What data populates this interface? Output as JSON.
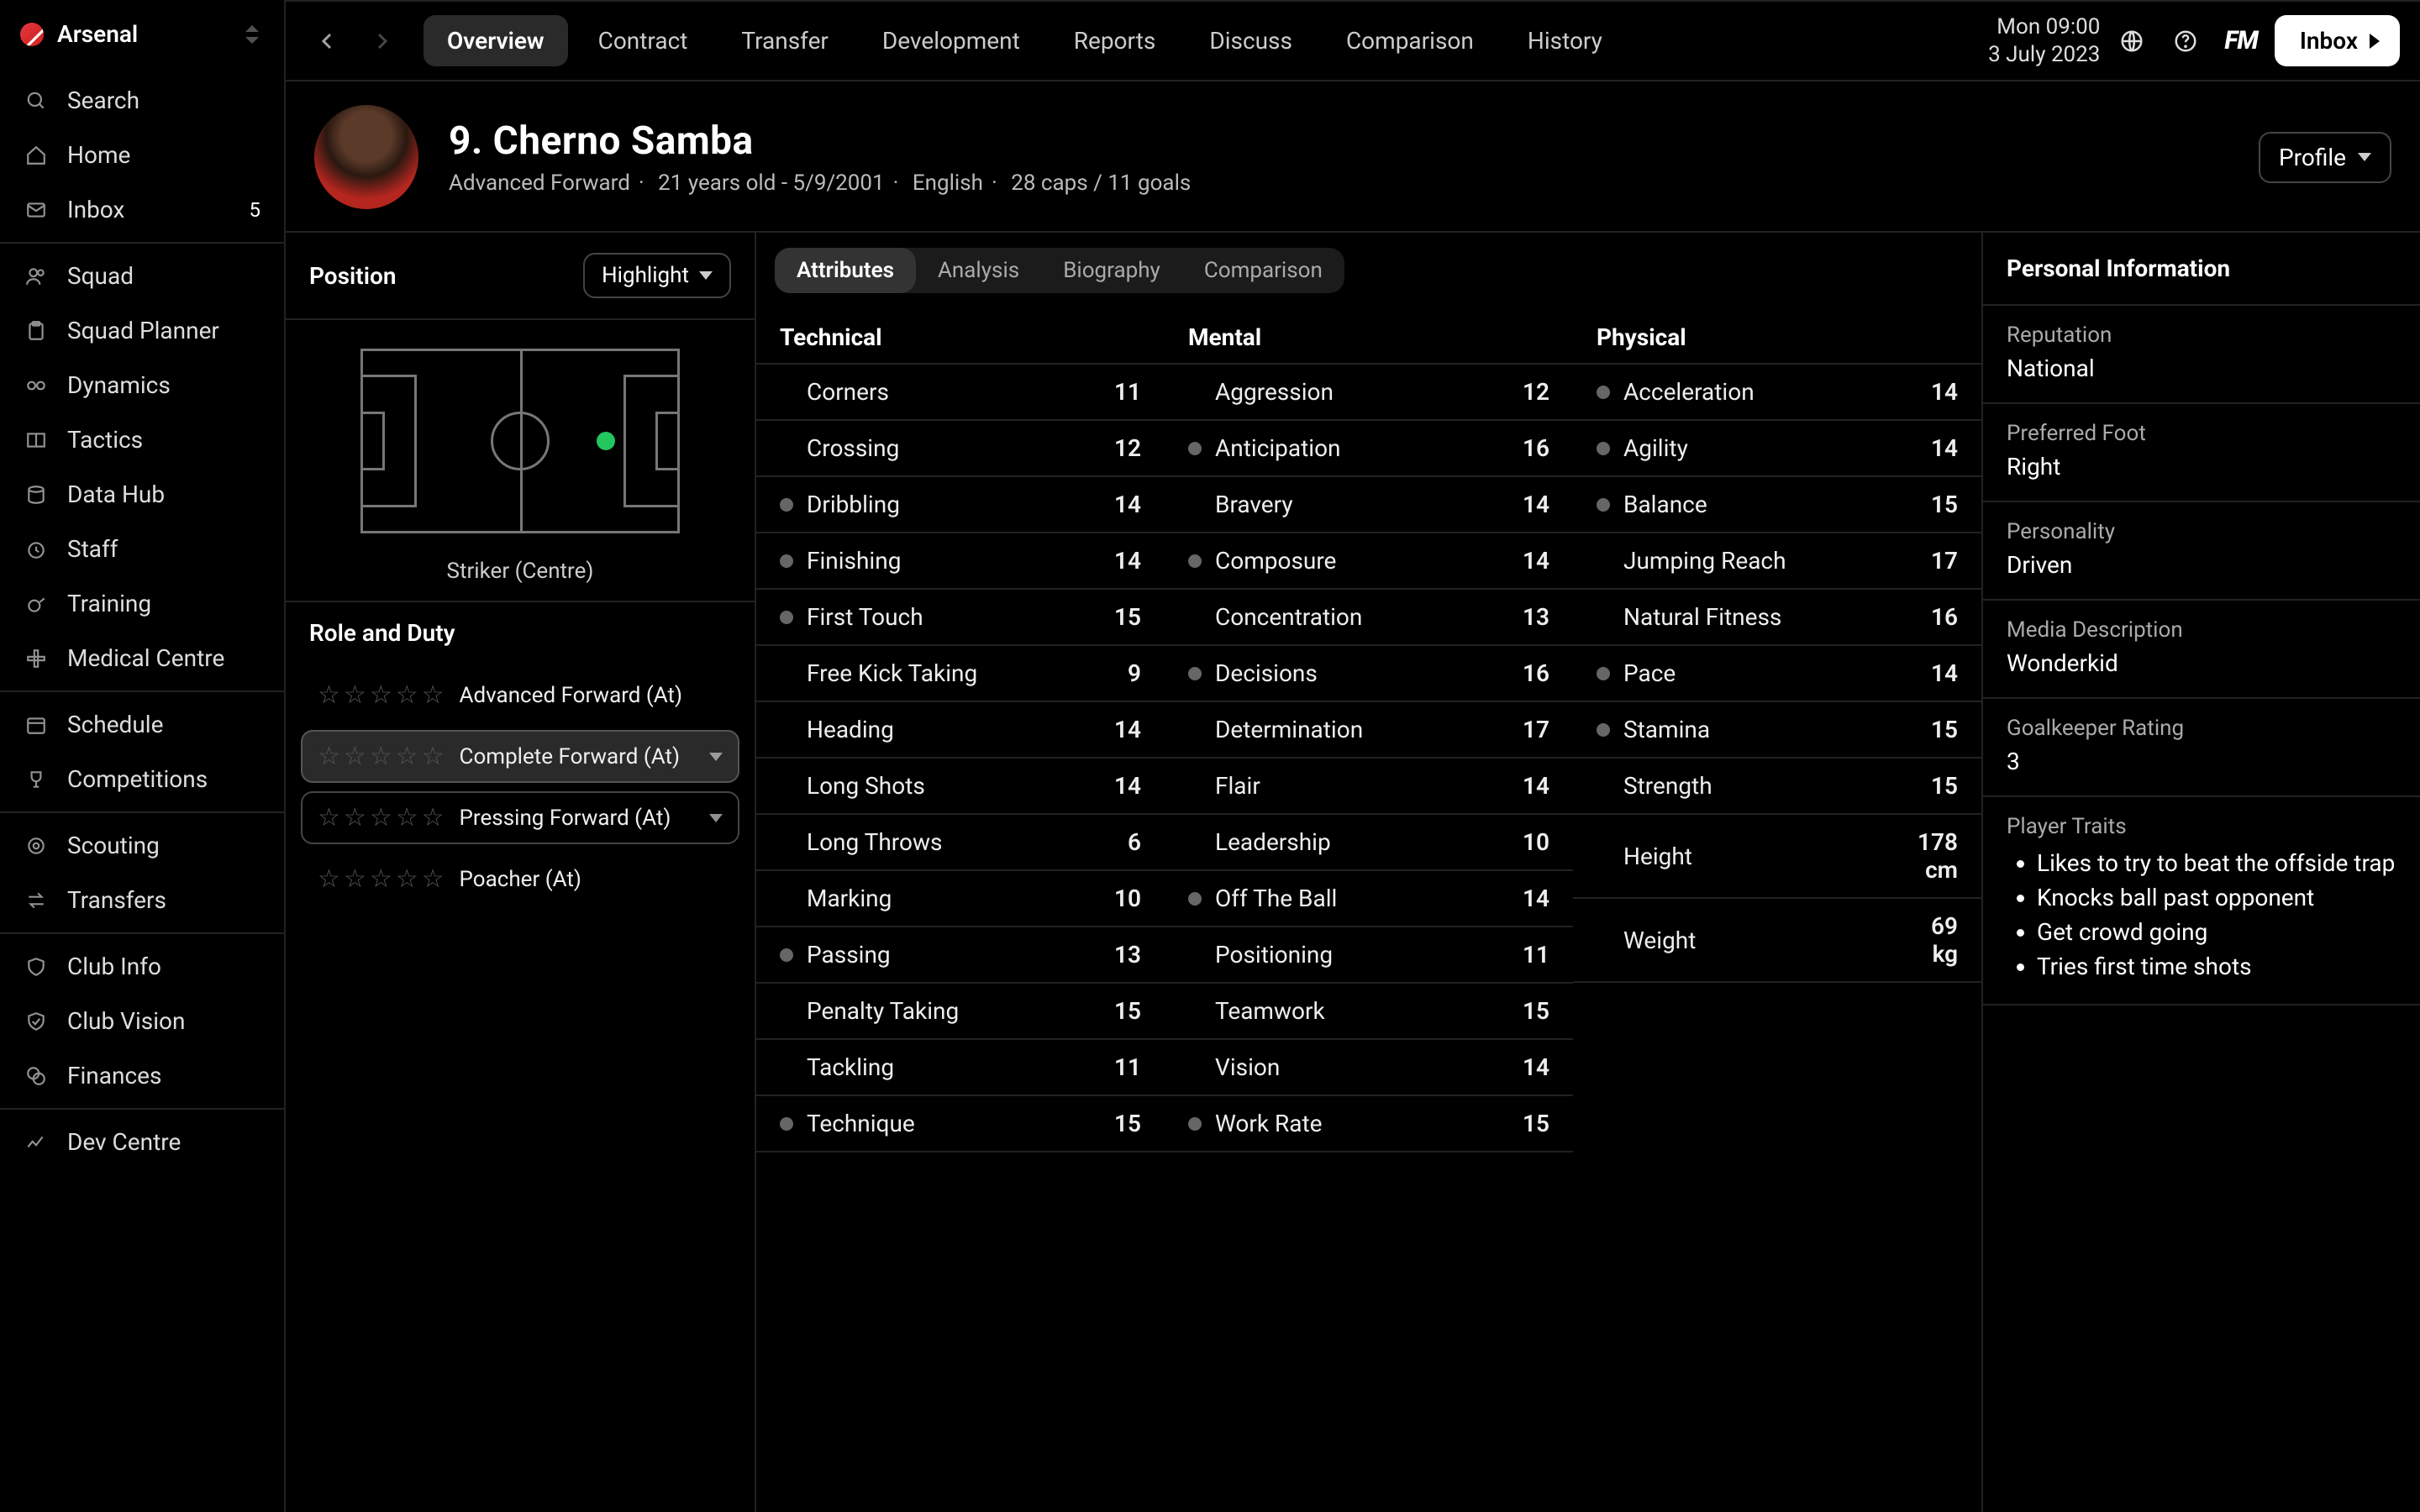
{
  "brand": {
    "name": "Arsenal"
  },
  "sidebar": {
    "search": "Search",
    "home": "Home",
    "inbox": "Inbox",
    "inbox_count": "5",
    "squad": "Squad",
    "squad_planner": "Squad Planner",
    "dynamics": "Dynamics",
    "tactics": "Tactics",
    "data_hub": "Data Hub",
    "staff": "Staff",
    "training": "Training",
    "medical": "Medical Centre",
    "schedule": "Schedule",
    "competitions": "Competitions",
    "scouting": "Scouting",
    "transfers": "Transfers",
    "club_info": "Club Info",
    "club_vision": "Club Vision",
    "finances": "Finances",
    "dev_centre": "Dev Centre"
  },
  "topbar": {
    "tabs": [
      "Overview",
      "Contract",
      "Transfer",
      "Development",
      "Reports",
      "Discuss",
      "Comparison",
      "History"
    ],
    "active": 0,
    "time": "Mon 09:00",
    "date": "3 July 2023",
    "fm": "FM",
    "inbox": "Inbox"
  },
  "profile_button": "Profile",
  "player": {
    "title": "9. Cherno Samba",
    "role": "Advanced Forward",
    "age": "21 years old - 5/9/2001",
    "nat": "English",
    "caps": "28 caps / 11 goals"
  },
  "position": {
    "heading": "Position",
    "highlight": "Highlight",
    "caption": "Striker (Centre)"
  },
  "role_duty": {
    "heading": "Role and Duty",
    "items": [
      {
        "label": "Advanced Forward (At)",
        "framed": false,
        "selected": false,
        "caret": false
      },
      {
        "label": "Complete Forward (At)",
        "framed": true,
        "selected": true,
        "caret": true
      },
      {
        "label": "Pressing Forward (At)",
        "framed": true,
        "selected": false,
        "caret": true
      },
      {
        "label": "Poacher (At)",
        "framed": false,
        "selected": false,
        "caret": false
      }
    ]
  },
  "pill_tabs": {
    "items": [
      "Attributes",
      "Analysis",
      "Biography",
      "Comparison"
    ],
    "active": 0
  },
  "attrs": {
    "technical": {
      "head": "Technical",
      "rows": [
        {
          "n": "Corners",
          "v": "11",
          "hl": false
        },
        {
          "n": "Crossing",
          "v": "12",
          "hl": false
        },
        {
          "n": "Dribbling",
          "v": "14",
          "hl": true
        },
        {
          "n": "Finishing",
          "v": "14",
          "hl": true
        },
        {
          "n": "First Touch",
          "v": "15",
          "hl": true
        },
        {
          "n": "Free Kick Taking",
          "v": "9",
          "hl": false
        },
        {
          "n": "Heading",
          "v": "14",
          "hl": false
        },
        {
          "n": "Long Shots",
          "v": "14",
          "hl": false
        },
        {
          "n": "Long Throws",
          "v": "6",
          "hl": false
        },
        {
          "n": "Marking",
          "v": "10",
          "hl": false
        },
        {
          "n": "Passing",
          "v": "13",
          "hl": true
        },
        {
          "n": "Penalty Taking",
          "v": "15",
          "hl": false
        },
        {
          "n": "Tackling",
          "v": "11",
          "hl": false
        },
        {
          "n": "Technique",
          "v": "15",
          "hl": true
        }
      ]
    },
    "mental": {
      "head": "Mental",
      "rows": [
        {
          "n": "Aggression",
          "v": "12",
          "hl": false
        },
        {
          "n": "Anticipation",
          "v": "16",
          "hl": true
        },
        {
          "n": "Bravery",
          "v": "14",
          "hl": false
        },
        {
          "n": "Composure",
          "v": "14",
          "hl": true
        },
        {
          "n": "Concentration",
          "v": "13",
          "hl": false
        },
        {
          "n": "Decisions",
          "v": "16",
          "hl": true
        },
        {
          "n": "Determination",
          "v": "17",
          "hl": false
        },
        {
          "n": "Flair",
          "v": "14",
          "hl": false
        },
        {
          "n": "Leadership",
          "v": "10",
          "hl": false
        },
        {
          "n": "Off The Ball",
          "v": "14",
          "hl": true
        },
        {
          "n": "Positioning",
          "v": "11",
          "hl": false
        },
        {
          "n": "Teamwork",
          "v": "15",
          "hl": false
        },
        {
          "n": "Vision",
          "v": "14",
          "hl": false
        },
        {
          "n": "Work Rate",
          "v": "15",
          "hl": true
        }
      ]
    },
    "physical": {
      "head": "Physical",
      "rows": [
        {
          "n": "Acceleration",
          "v": "14",
          "hl": true
        },
        {
          "n": "Agility",
          "v": "14",
          "hl": true
        },
        {
          "n": "Balance",
          "v": "15",
          "hl": true
        },
        {
          "n": "Jumping Reach",
          "v": "17",
          "hl": false
        },
        {
          "n": "Natural Fitness",
          "v": "16",
          "hl": false
        },
        {
          "n": "Pace",
          "v": "14",
          "hl": true
        },
        {
          "n": "Stamina",
          "v": "15",
          "hl": true
        },
        {
          "n": "Strength",
          "v": "15",
          "hl": false
        },
        {
          "n": "Height",
          "v": "178 cm",
          "hl": false
        },
        {
          "n": "Weight",
          "v": "69 kg",
          "hl": false
        }
      ]
    }
  },
  "info": {
    "heading": "Personal Information",
    "reputation": {
      "label": "Reputation",
      "value": "National"
    },
    "foot": {
      "label": "Preferred Foot",
      "value": "Right"
    },
    "personality": {
      "label": "Personality",
      "value": "Driven"
    },
    "media": {
      "label": "Media Description",
      "value": "Wonderkid"
    },
    "gk": {
      "label": "Goalkeeper Rating",
      "value": "3"
    },
    "traits": {
      "label": "Player Traits",
      "items": [
        "Likes to try to beat the offside trap",
        "Knocks ball past opponent",
        "Get crowd going",
        "Tries first time shots"
      ]
    }
  }
}
